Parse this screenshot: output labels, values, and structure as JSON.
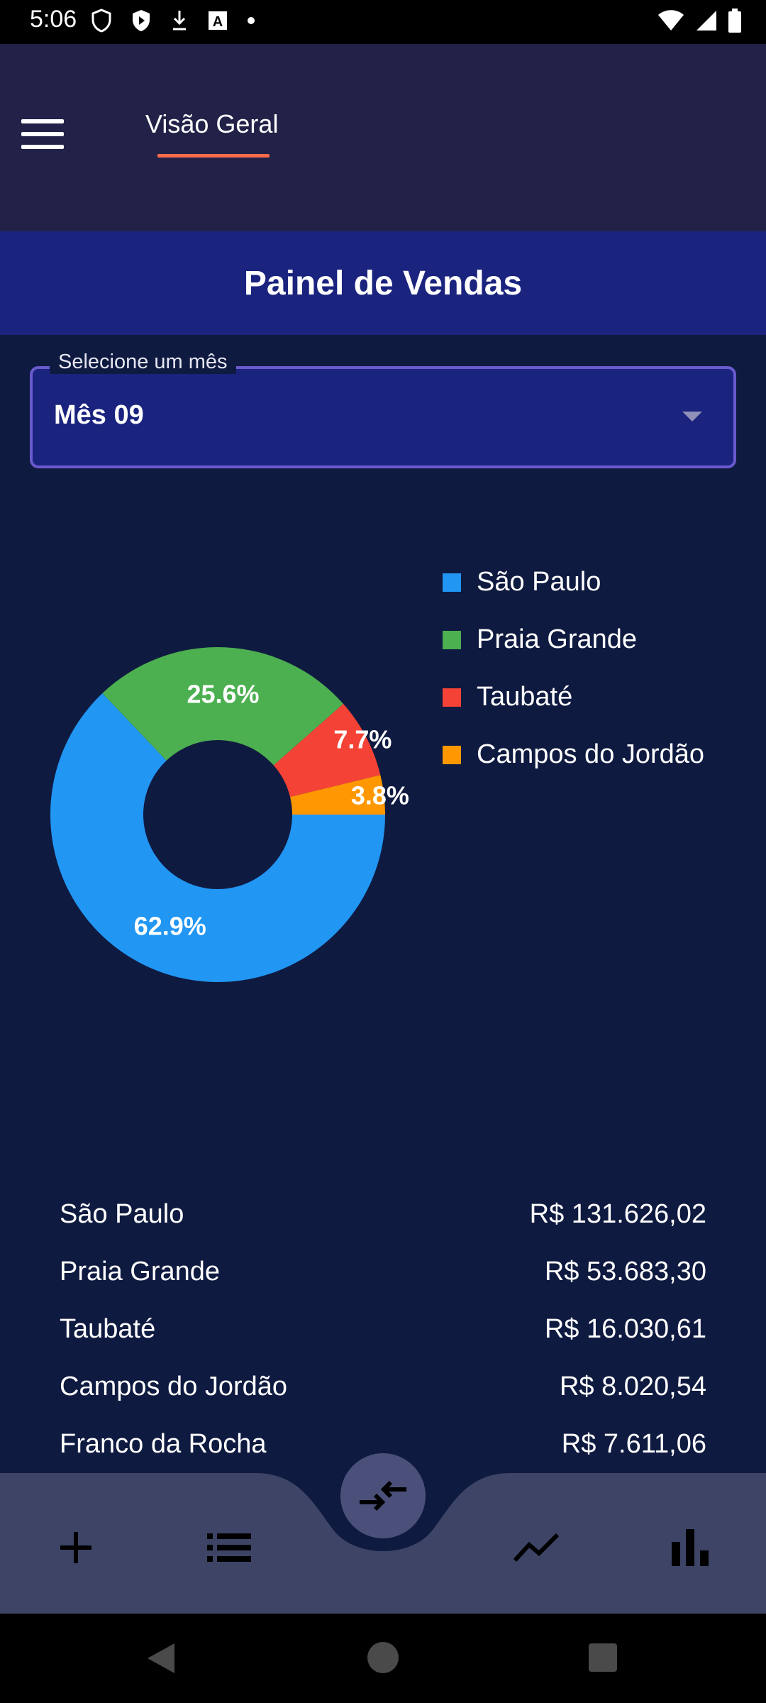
{
  "status_bar": {
    "time": "5:06"
  },
  "header": {
    "tab_label": "Visão Geral"
  },
  "page": {
    "title": "Painel de Vendas"
  },
  "month_select": {
    "label": "Selecione um mês",
    "value": "Mês 09"
  },
  "chart_data": {
    "type": "pie",
    "donut": true,
    "categories": [
      "São Paulo",
      "Praia Grande",
      "Taubaté",
      "Campos do Jordão"
    ],
    "values": [
      62.9,
      25.6,
      7.7,
      3.8
    ],
    "value_labels": [
      "62.9%",
      "25.6%",
      "7.7%",
      "3.8%"
    ],
    "colors": [
      "#2196f3",
      "#4caf50",
      "#f44336",
      "#ff9800"
    ],
    "legend_position": "right"
  },
  "legend": [
    {
      "label": "São Paulo",
      "color": "#2196f3"
    },
    {
      "label": "Praia Grande",
      "color": "#4caf50"
    },
    {
      "label": "Taubaté",
      "color": "#f44336"
    },
    {
      "label": "Campos do Jordão",
      "color": "#ff9800"
    }
  ],
  "totals": [
    {
      "city": "São Paulo",
      "amount": "R$ 131.626,02"
    },
    {
      "city": "Praia Grande",
      "amount": "R$ 53.683,30"
    },
    {
      "city": "Taubaté",
      "amount": "R$ 16.030,61"
    },
    {
      "city": "Campos do Jordão",
      "amount": "R$ 8.020,54"
    },
    {
      "city": "Franco da Rocha",
      "amount": "R$ 7.611,06"
    }
  ],
  "bottom_nav": {
    "items": [
      "plus-icon",
      "list-icon",
      "compare-arrows-icon",
      "trending-icon",
      "bar-chart-icon"
    ],
    "background": "#3d4466"
  }
}
